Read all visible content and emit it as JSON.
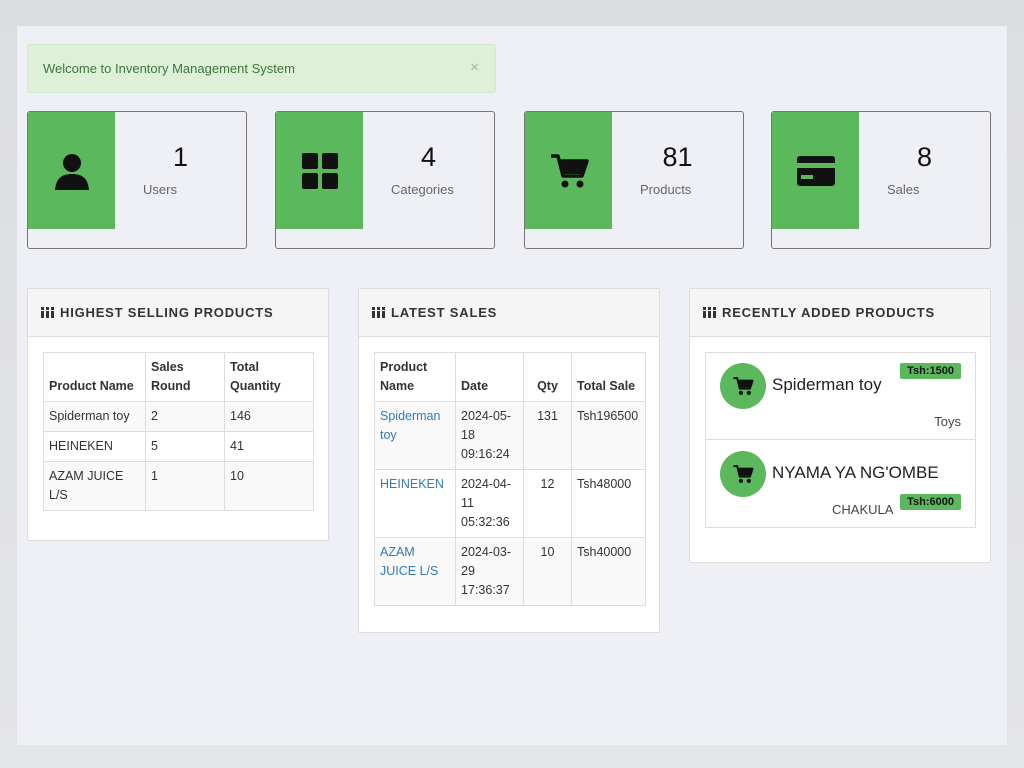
{
  "alert": {
    "message": "Welcome to Inventory Management System",
    "close": "×"
  },
  "stats": [
    {
      "value": "1",
      "label": "Users",
      "icon": "user-icon"
    },
    {
      "value": "4",
      "label": "Categories",
      "icon": "grid-icon"
    },
    {
      "value": "81",
      "label": "Products",
      "icon": "cart-icon"
    },
    {
      "value": "8",
      "label": "Sales",
      "icon": "credit-card-icon"
    }
  ],
  "highest_selling": {
    "title": "HIGHEST SELLING PRODUCTS",
    "headers": [
      "Product Name",
      "Sales Round",
      "Total Quantity"
    ],
    "rows": [
      [
        "Spiderman toy",
        "2",
        "146"
      ],
      [
        "HEINEKEN",
        "5",
        "41"
      ],
      [
        "AZAM JUICE L/S",
        "1",
        "10"
      ]
    ]
  },
  "latest_sales": {
    "title": "LATEST SALES",
    "headers": [
      "Product Name",
      "Date",
      "Qty",
      "Total Sale"
    ],
    "rows": [
      [
        "Spiderman toy",
        "2024-05-18 09:16:24",
        "131",
        "Tsh196500"
      ],
      [
        "HEINEKEN",
        "2024-04-11 05:32:36",
        "12",
        "Tsh48000"
      ],
      [
        "AZAM JUICE L/S",
        "2024-03-29 17:36:37",
        "10",
        "Tsh40000"
      ]
    ]
  },
  "recent_products": {
    "title": "RECENTLY ADDED PRODUCTS",
    "items": [
      {
        "name": "Spiderman toy",
        "price": "Tsh:1500",
        "category": "Toys"
      },
      {
        "name": "NYAMA YA NG'OMBE",
        "price": "Tsh:6000",
        "category": "CHAKULA"
      }
    ]
  },
  "colors": {
    "accent": "#5cb85c",
    "alert_bg": "#dff0d8",
    "alert_text": "#3c763d",
    "link": "#337ab7"
  }
}
